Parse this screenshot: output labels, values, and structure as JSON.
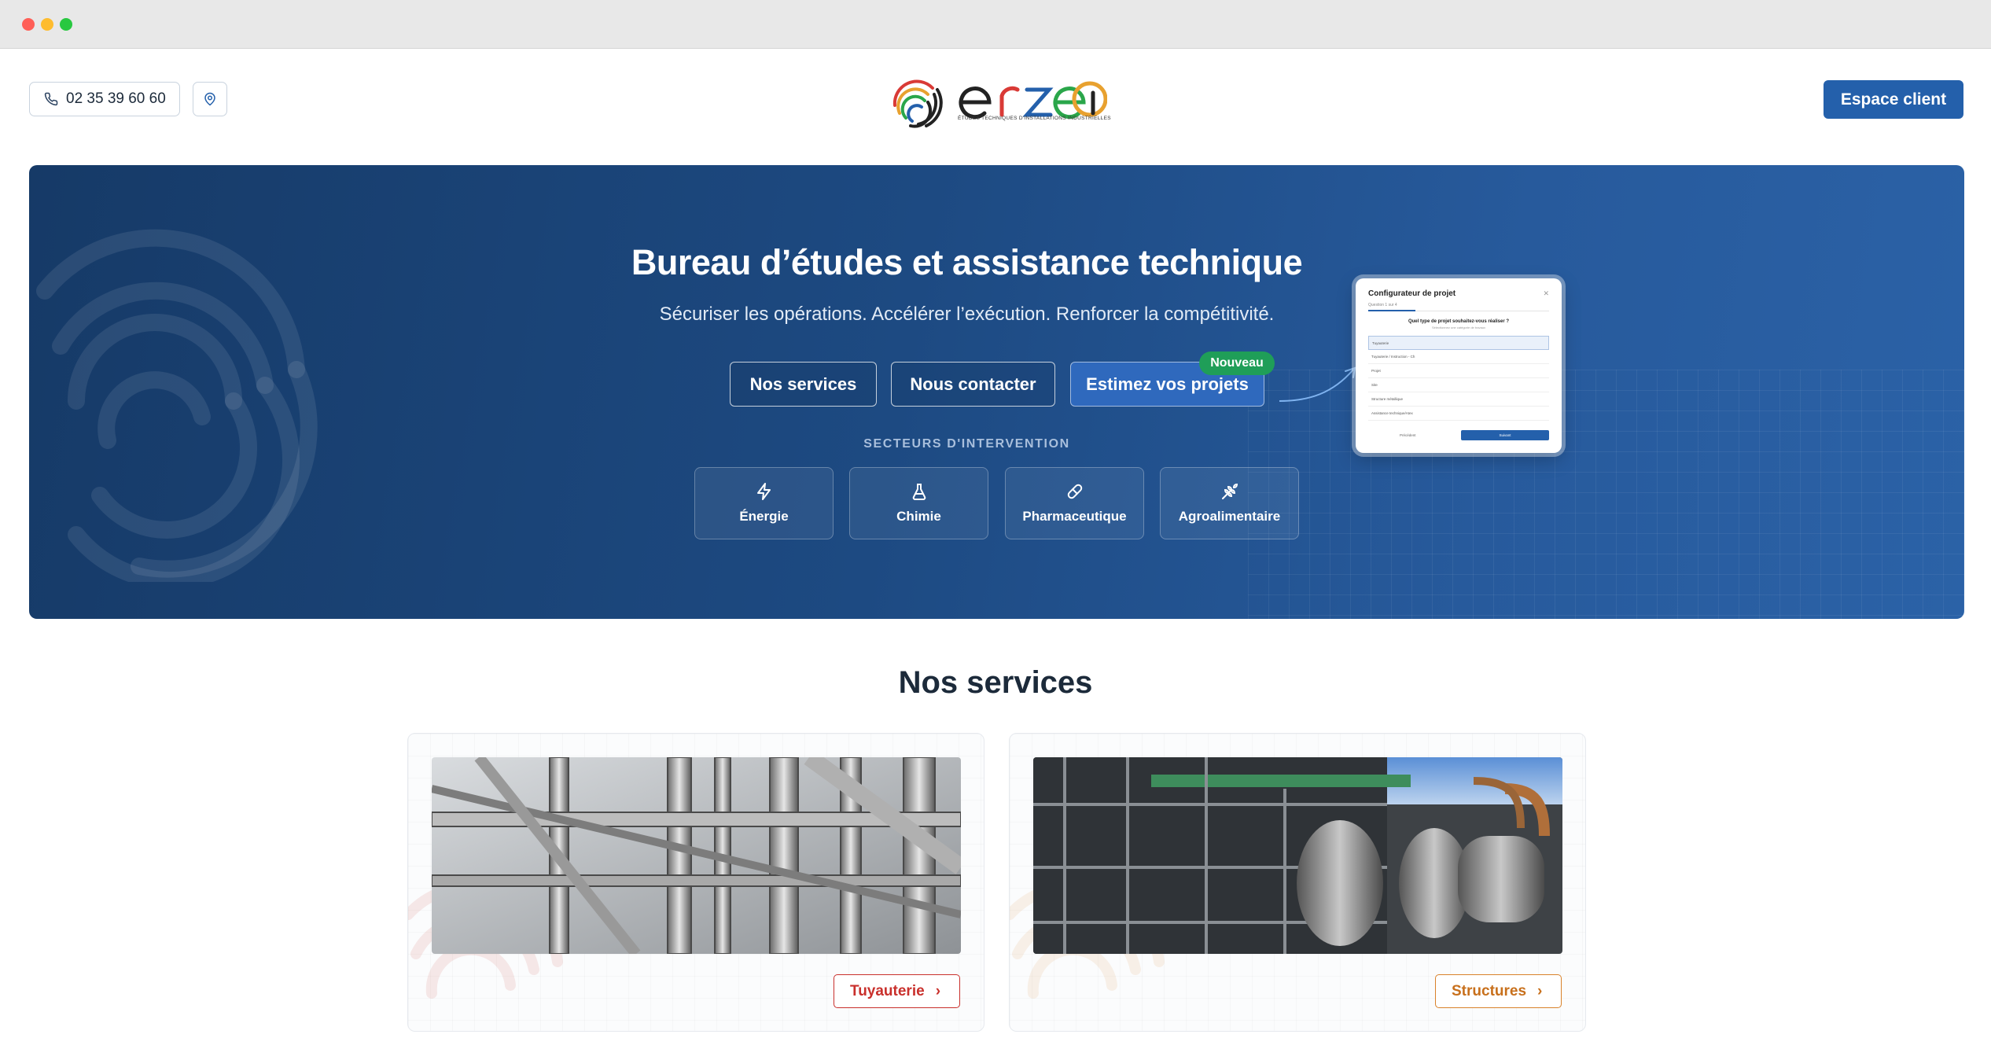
{
  "header": {
    "phone": "02 35 39 60 60",
    "logo_wordmark": "eTEII",
    "logo_tagline": "ÉTUDES TECHNIQUES D'INSTALLATIONS INDUSTRIELLES",
    "client_button": "Espace client"
  },
  "hero": {
    "title": "Bureau d’études et assistance technique",
    "subtitle": "Sécuriser les opérations. Accélérer l’exécution. Renforcer la compétitivité.",
    "buttons": {
      "services": "Nos services",
      "contact": "Nous contacter",
      "estimate": "Estimez vos projets"
    },
    "badge": "Nouveau",
    "sectors_title": "SECTEURS D'INTERVENTION",
    "sectors": [
      {
        "label": "Énergie",
        "icon": "lightning-icon"
      },
      {
        "label": "Chimie",
        "icon": "flask-icon"
      },
      {
        "label": "Pharmaceutique",
        "icon": "pill-icon"
      },
      {
        "label": "Agroalimentaire",
        "icon": "wheat-icon"
      }
    ]
  },
  "configurator": {
    "title": "Configurateur de projet",
    "step": "Question 1 sur 4",
    "question": "Quel type de projet souhaitez-vous réaliser ?",
    "question_hint": "Sélectionnez une catégorie de travaux",
    "options": [
      "Tuyauterie",
      "Tuyauterie / Instruction - Ch",
      "Projet",
      "Site",
      "Structure métallique",
      "Assistance technique/Atex"
    ],
    "prev": "Précédent",
    "next": "Suivant"
  },
  "services": {
    "title": "Nos services",
    "cards": [
      {
        "button": "Tuyauterie",
        "accent": "#c9302c"
      },
      {
        "button": "Structures",
        "accent": "#d9822b"
      }
    ]
  },
  "colors": {
    "primary": "#2460ab",
    "hero_dark": "#163a67",
    "badge_green": "#1f9e58"
  }
}
